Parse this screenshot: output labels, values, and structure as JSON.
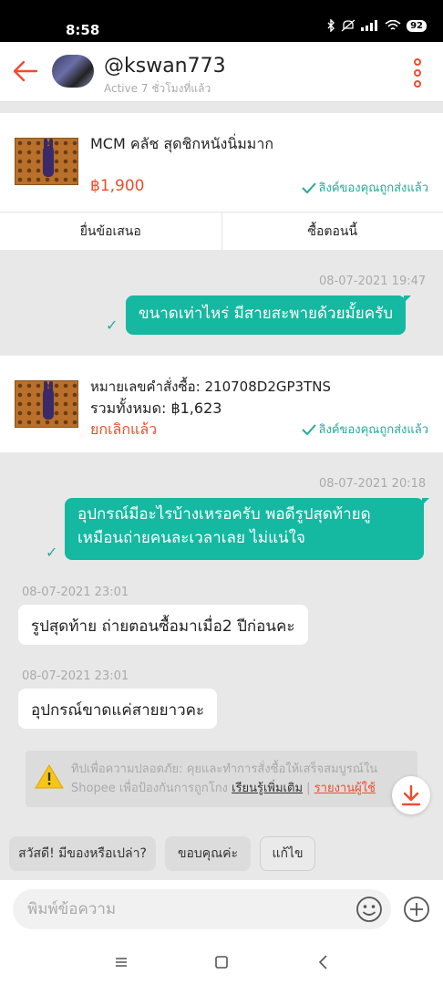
{
  "status_bar": {
    "time": "8:58",
    "battery": "92",
    "icons": [
      "bluetooth-icon",
      "mute-icon",
      "signal-icon",
      "wifi-icon",
      "battery-icon"
    ]
  },
  "header": {
    "username": "@kswan773",
    "active_status": "Active 7 ชั่วโมงที่แล้ว"
  },
  "product": {
    "title": "MCM คลัช สุดชิกหนังนิ่มมาก",
    "price": "฿1,900",
    "sent_note": "ลิงค์ของคุณถูกส่งแล้ว",
    "offer_button": "ยื่นข้อเสนอ",
    "buy_button": "ซื้อตอนนี้"
  },
  "messages": [
    {
      "timestamp": "08-07-2021 19:47",
      "text": "ขนาดเท่าไหร่ มีสายสะพายด้วยมั้ยครับ",
      "direction": "out"
    },
    {
      "timestamp": "08-07-2021 20:18",
      "text_line1": "อุปกรณ์มีอะไรบ้างเหรอครับ พอดีรูปสุดท้ายดู",
      "text_line2": "เหมือนถ่ายคนละเวลาเลย ไม่แน่ใจ",
      "direction": "out"
    },
    {
      "timestamp": "08-07-2021 23:01",
      "text": "รูปสุดท้าย ถ่ายตอนซื้อมาเมื่อ2 ปีก่อนคะ",
      "direction": "in"
    },
    {
      "timestamp": "08-07-2021 23:01",
      "text": "อุปกรณ์ขาดแค่สายยาวคะ",
      "direction": "in"
    }
  ],
  "order": {
    "order_number": "หมายเลขคำสั่งซื้อ: 210708D2GP3TNS",
    "total": "รวมทั้งหมด: ฿1,623",
    "status": "ยกเลิกแล้ว",
    "sent_note": "ลิงค์ของคุณถูกส่งแล้ว"
  },
  "safety_tip": {
    "line1": "ทิปเพื่อความปลอดภัย: คุยและทำการสั่งซื้อให้เสร็จสมบูรณ์ใน",
    "line2": "Shopee เพื่อป้องกันการถูกโกง",
    "learn_more": "เรียนรู้เพิ่มเติม",
    "separator": "|",
    "report": "รายงานผู้ใช้"
  },
  "quick_replies": [
    "สวัสดี! มีของหรือเปล่า?",
    "ขอบคุณค่ะ",
    "แก้ไข"
  ],
  "composer": {
    "placeholder": "พิมพ์ข้อความ"
  },
  "colors": {
    "accent": "#ee4d2d",
    "teal": "#15b8a0",
    "sent_green": "#26aa99"
  }
}
